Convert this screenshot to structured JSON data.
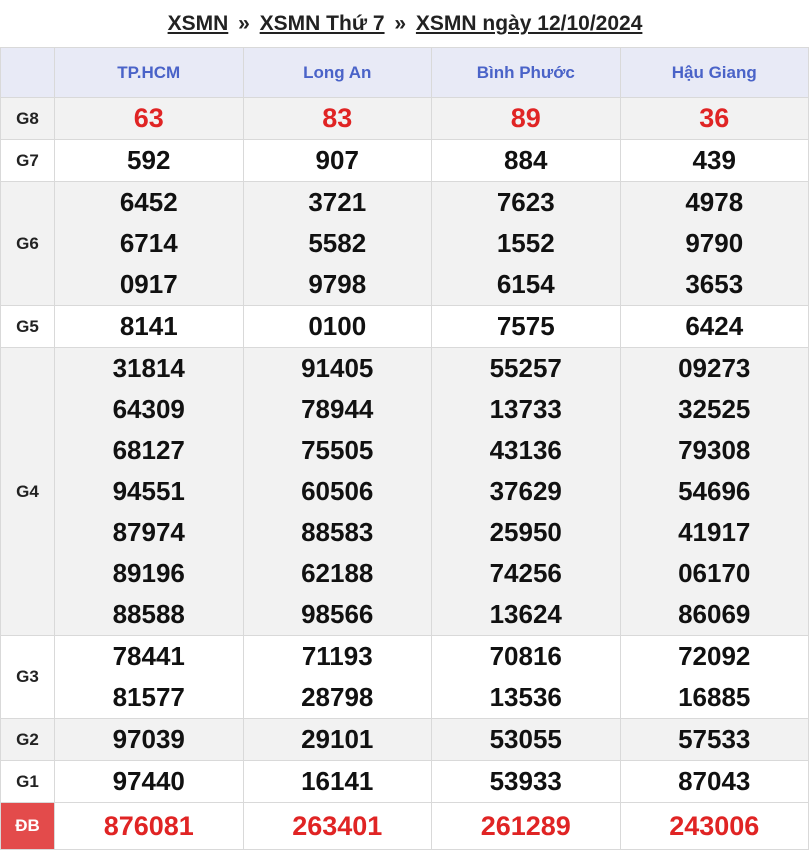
{
  "breadcrumb": {
    "part1": "XSMN",
    "part2": "XSMN Thứ 7",
    "part3": "XSMN ngày 12/10/2024",
    "separator": "»"
  },
  "provinces": [
    "TP.HCM",
    "Long An",
    "Bình Phước",
    "Hậu Giang"
  ],
  "prizes": [
    {
      "label": "G8",
      "values": [
        [
          "63"
        ],
        [
          "83"
        ],
        [
          "89"
        ],
        [
          "36"
        ]
      ]
    },
    {
      "label": "G7",
      "values": [
        [
          "592"
        ],
        [
          "907"
        ],
        [
          "884"
        ],
        [
          "439"
        ]
      ]
    },
    {
      "label": "G6",
      "values": [
        [
          "6452",
          "6714",
          "0917"
        ],
        [
          "3721",
          "5582",
          "9798"
        ],
        [
          "7623",
          "1552",
          "6154"
        ],
        [
          "4978",
          "9790",
          "3653"
        ]
      ]
    },
    {
      "label": "G5",
      "values": [
        [
          "8141"
        ],
        [
          "0100"
        ],
        [
          "7575"
        ],
        [
          "6424"
        ]
      ]
    },
    {
      "label": "G4",
      "values": [
        [
          "31814",
          "64309",
          "68127",
          "94551",
          "87974",
          "89196",
          "88588"
        ],
        [
          "91405",
          "78944",
          "75505",
          "60506",
          "88583",
          "62188",
          "98566"
        ],
        [
          "55257",
          "13733",
          "43136",
          "37629",
          "25950",
          "74256",
          "13624"
        ],
        [
          "09273",
          "32525",
          "79308",
          "54696",
          "41917",
          "06170",
          "86069"
        ]
      ]
    },
    {
      "label": "G3",
      "values": [
        [
          "78441",
          "81577"
        ],
        [
          "71193",
          "28798"
        ],
        [
          "70816",
          "13536"
        ],
        [
          "72092",
          "16885"
        ]
      ]
    },
    {
      "label": "G2",
      "values": [
        [
          "97039"
        ],
        [
          "29101"
        ],
        [
          "53055"
        ],
        [
          "57533"
        ]
      ]
    },
    {
      "label": "G1",
      "values": [
        [
          "97440"
        ],
        [
          "16141"
        ],
        [
          "53933"
        ],
        [
          "87043"
        ]
      ]
    },
    {
      "label": "ĐB",
      "values": [
        [
          "876081"
        ],
        [
          "263401"
        ],
        [
          "261289"
        ],
        [
          "243006"
        ]
      ]
    }
  ],
  "colors": {
    "header_bg": "#e8eaf6",
    "header_text": "#4a63c8",
    "highlight_red": "#e02424",
    "db_label_bg": "#e34b4b",
    "alt_row_bg": "#f2f2f2"
  }
}
